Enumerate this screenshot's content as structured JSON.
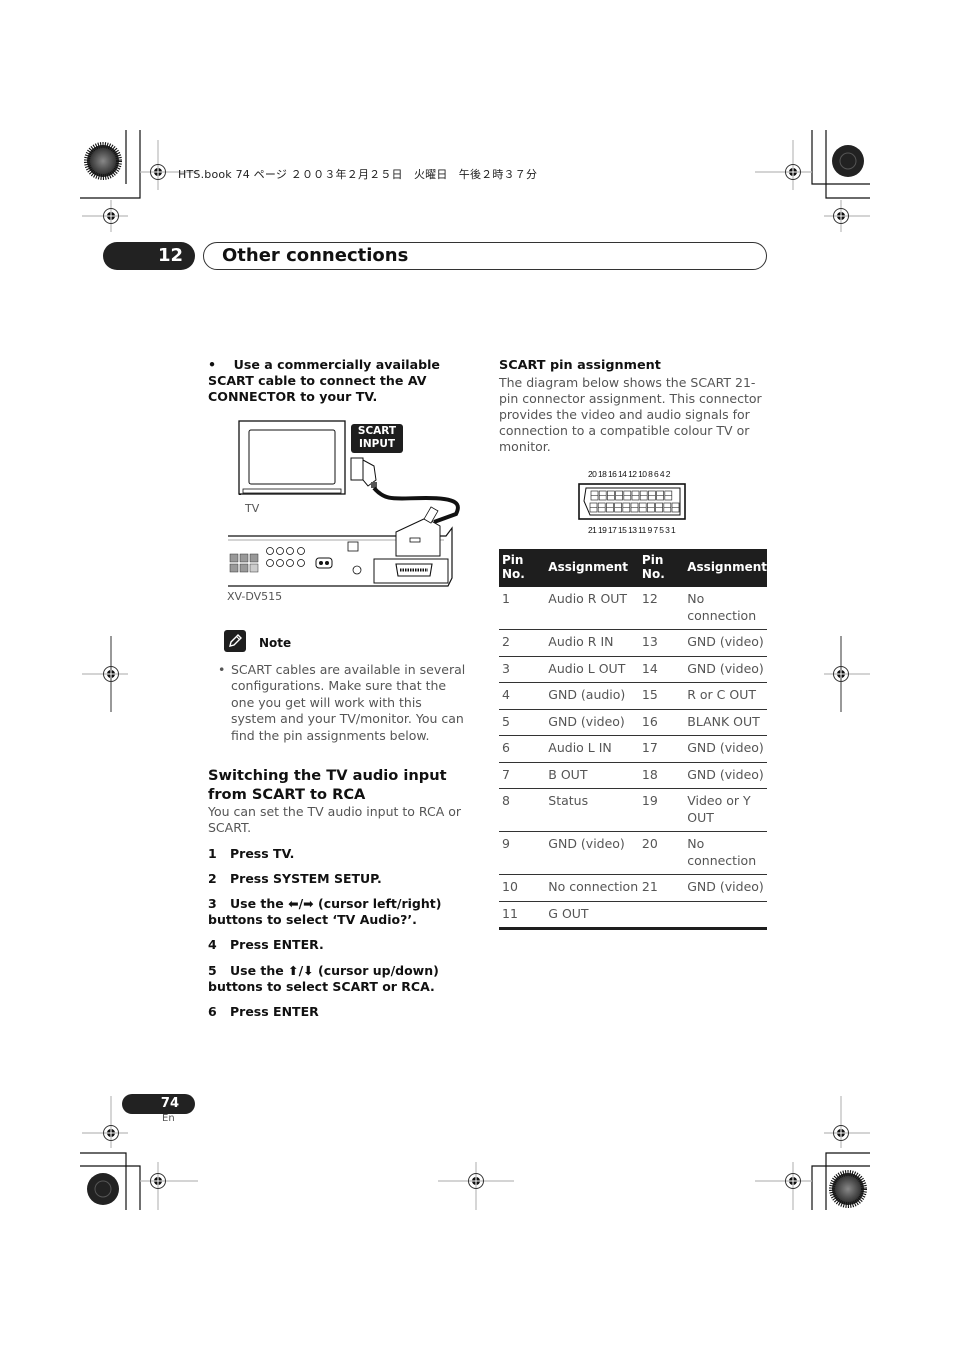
{
  "print_header": {
    "file_line": "HTS.book  74 ページ  ２００３年２月２５日　火曜日　午後２時３７分"
  },
  "chapter": {
    "number": "12",
    "title": "Other connections"
  },
  "left_column": {
    "instruction_bullet": "•",
    "instruction": "Use a commercially available SCART cable to connect the AV CONNECTOR to your TV.",
    "figure": {
      "badge_line1": "SCART",
      "badge_line2": "INPUT",
      "tv_label": "TV",
      "device_label": "XV-DV515"
    },
    "note": {
      "icon": "pencil-note-icon",
      "label": "Note",
      "bullet": "•",
      "text": "SCART cables are available in several configurations. Make sure that the one you get will work with this system and your TV/monitor. You can find the pin assignments below."
    },
    "section_title": "Switching the TV audio input from SCART to RCA",
    "section_desc": "You can set the TV audio input to RCA or SCART.",
    "steps": [
      {
        "n": "1",
        "text": "Press TV."
      },
      {
        "n": "2",
        "text": "Press SYSTEM SETUP."
      },
      {
        "n": "3",
        "text": "Use the ⬅/➡ (cursor left/right) buttons to select ‘TV Audio?’."
      },
      {
        "n": "4",
        "text": "Press ENTER."
      },
      {
        "n": "5",
        "text": "Use the ⬆/⬇ (cursor up/down) buttons to select SCART or RCA."
      },
      {
        "n": "6",
        "text": "Press ENTER"
      }
    ]
  },
  "right_column": {
    "title": "SCART pin assignment",
    "desc": "The diagram below shows the SCART 21-pin connector assignment. This connector provides the video and audio signals for connection to a compatible colour TV or monitor.",
    "pin_numbers_top": "20 18 16 14 12 10  8  6  4  2",
    "pin_numbers_bottom": "21 19 17 15 13 11  9  7  5  3  1",
    "table": {
      "headers": [
        "Pin No.",
        "Assignment",
        "Pin No.",
        "Assignment"
      ],
      "rows": [
        [
          "1",
          "Audio R OUT",
          "12",
          "No connection"
        ],
        [
          "2",
          "Audio R IN",
          "13",
          "GND (video)"
        ],
        [
          "3",
          "Audio L OUT",
          "14",
          "GND (video)"
        ],
        [
          "4",
          "GND (audio)",
          "15",
          "R or C OUT"
        ],
        [
          "5",
          "GND (video)",
          "16",
          "BLANK OUT"
        ],
        [
          "6",
          "Audio L IN",
          "17",
          "GND (video)"
        ],
        [
          "7",
          "B OUT",
          "18",
          "GND (video)"
        ],
        [
          "8",
          "Status",
          "19",
          "Video or Y OUT"
        ],
        [
          "9",
          "GND (video)",
          "20",
          "No connection"
        ],
        [
          "10",
          "No connection",
          "21",
          "GND (video)"
        ],
        [
          "11",
          "G OUT",
          "",
          ""
        ]
      ]
    }
  },
  "footer": {
    "page_number": "74",
    "language": "En"
  }
}
